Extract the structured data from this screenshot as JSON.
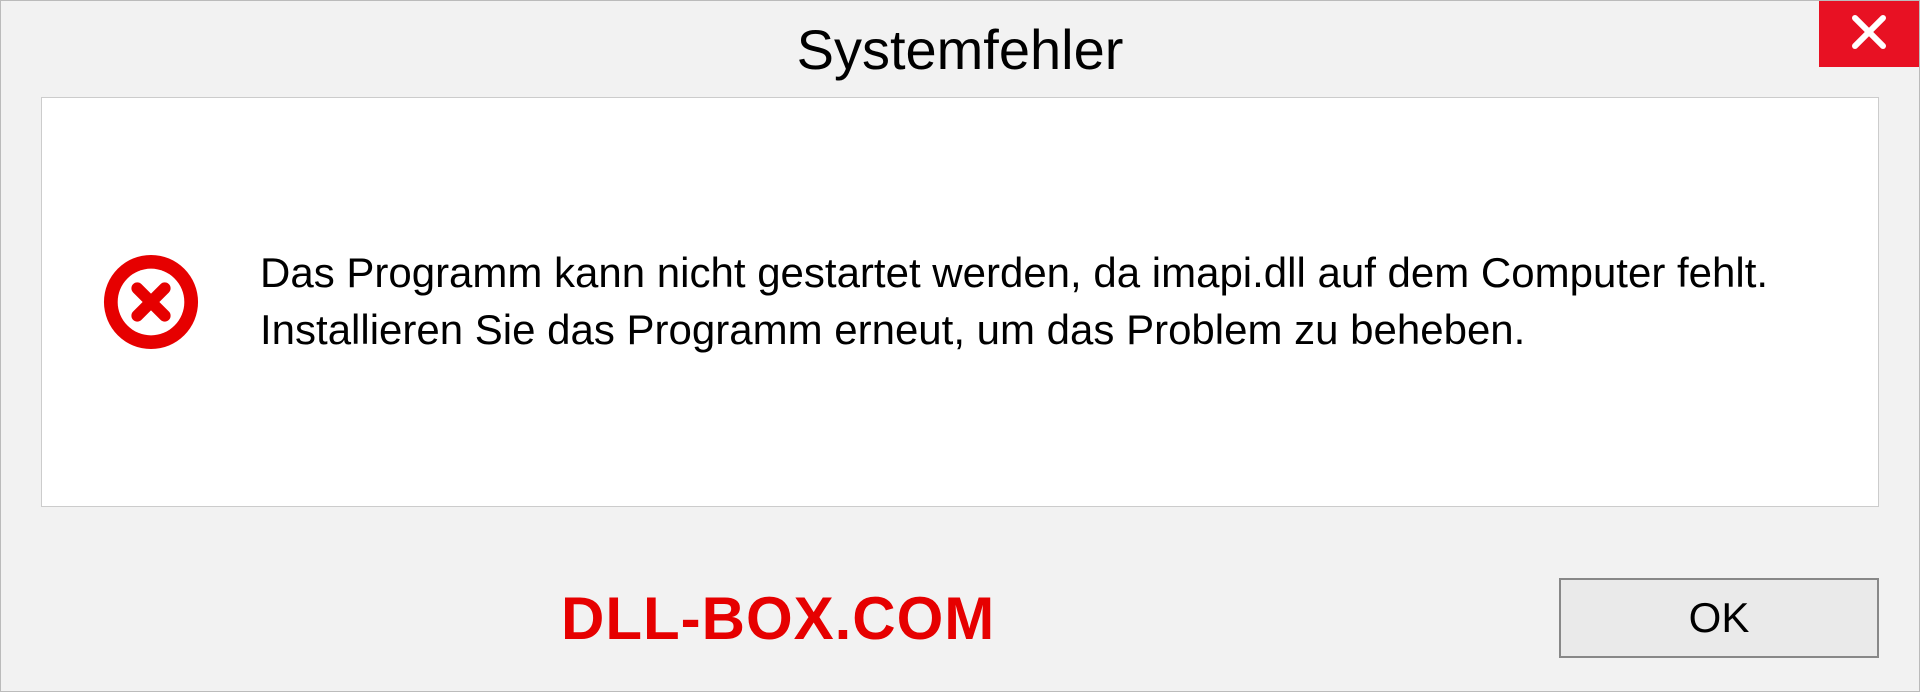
{
  "dialog": {
    "title": "Systemfehler",
    "message": "Das Programm kann nicht gestartet werden, da imapi.dll auf dem Computer fehlt. Installieren Sie das Programm erneut, um das Problem zu beheben.",
    "ok_label": "OK"
  },
  "watermark": "DLL-BOX.COM"
}
